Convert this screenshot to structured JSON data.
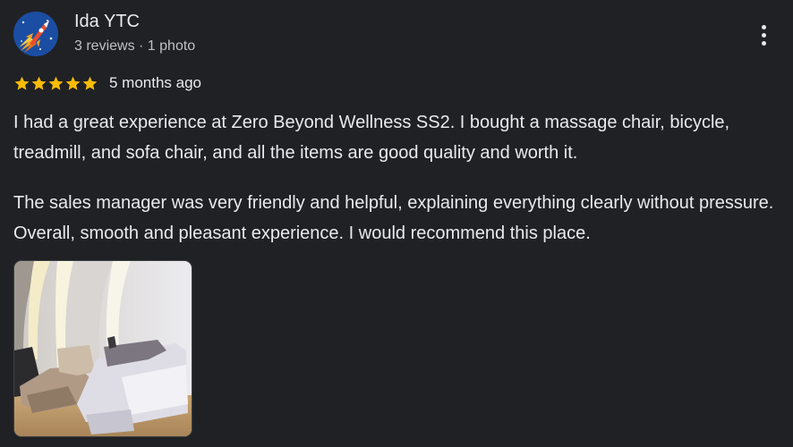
{
  "review": {
    "author_name": "Ida YTC",
    "author_meta": "3 reviews · 1 photo",
    "avatar_icon": "rocket-avatar-icon",
    "menu_icon": "more-vert-icon",
    "rating": 5,
    "rating_max": 5,
    "time_ago": "5 months ago",
    "paragraphs": [
      "I had a great experience at Zero Beyond Wellness SS2. I bought a massage chair, bicycle, treadmill, and sofa chair, and all the items are good quality and worth it.",
      "The sales manager was very friendly and helpful, explaining everything clearly without pressure. Overall, smooth and pleasant experience. I would recommend this place."
    ],
    "photo_icon": "showroom-massage-chairs-photo"
  },
  "colors": {
    "background": "#202124",
    "text": "#e8eaed",
    "secondary_text": "#bdc1c6",
    "star": "#fbbc04"
  }
}
